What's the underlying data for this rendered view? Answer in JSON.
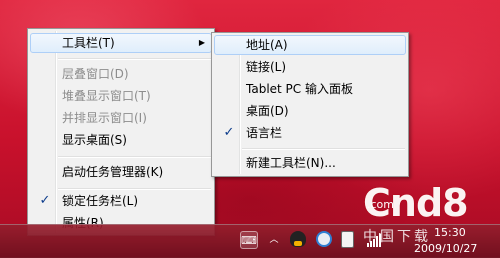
{
  "main_menu": {
    "items": [
      {
        "label": "工具栏(T)",
        "has_submenu": true,
        "highlighted": true
      },
      {
        "label": "层叠窗口(D)",
        "disabled": true
      },
      {
        "label": "堆叠显示窗口(T)",
        "disabled": true
      },
      {
        "label": "并排显示窗口(I)",
        "disabled": true
      },
      {
        "label": "显示桌面(S)"
      },
      {
        "label": "启动任务管理器(K)"
      },
      {
        "label": "锁定任务栏(L)",
        "checked": true
      },
      {
        "label": "属性(R)"
      }
    ],
    "check_glyph": "✓",
    "arrow_glyph": "▶"
  },
  "toolbar_submenu": {
    "items": [
      {
        "label": "地址(A)",
        "highlighted": true
      },
      {
        "label": "链接(L)"
      },
      {
        "label": "Tablet PC 输入面板"
      },
      {
        "label": "桌面(D)"
      },
      {
        "label": "语言栏",
        "checked": true
      },
      {
        "label": "新建工具栏(N)..."
      }
    ]
  },
  "taskbar": {
    "clock_time": "15:30",
    "clock_date": "2009/10/27",
    "tray_icons": [
      "keyboard-icon",
      "qq-penguin-icon",
      "network-icon",
      "phone-icon",
      "signal-icon"
    ]
  },
  "watermark": {
    "logo_text": "Cnd8",
    "dotcom": ".com",
    "tagline": "中国下载"
  },
  "colors": {
    "desktop_red": "#c8112c",
    "menu_bg": "#f1f1f1",
    "highlight_border": "#aecff7",
    "disabled_text": "#8d8d8d"
  }
}
